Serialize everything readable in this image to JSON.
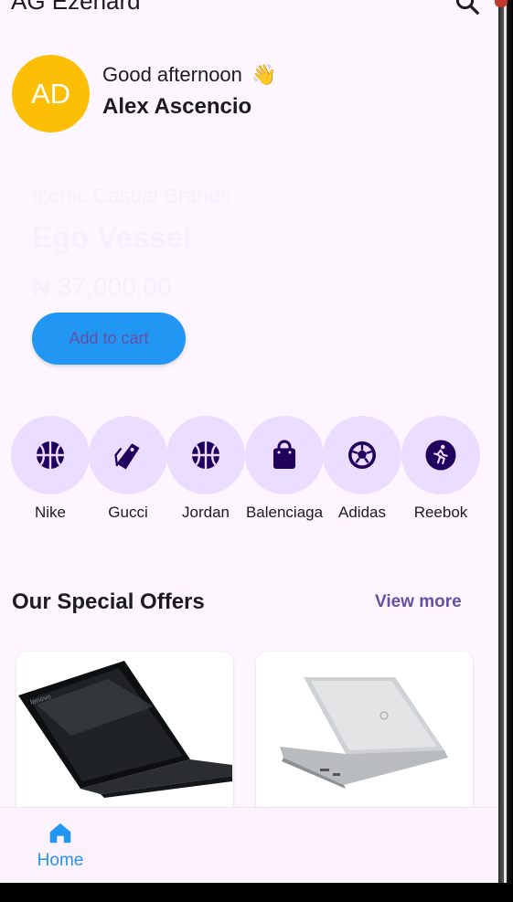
{
  "app_bar": {
    "title": "AG Ezenard"
  },
  "greeting": {
    "avatar_initials": "AD",
    "text": "Good afternoon",
    "emoji": "👋",
    "name": "Alex Ascencio"
  },
  "banner": {
    "subtitle": "Iconic Casual Brands",
    "title": "Ego Vessel",
    "price": "₦ 37,000.00",
    "button_label": "Add to cart"
  },
  "brands": [
    {
      "label": "Nike",
      "icon": "basketball-icon"
    },
    {
      "label": "Gucci",
      "icon": "tag-icon"
    },
    {
      "label": "Jordan",
      "icon": "basketball-icon"
    },
    {
      "label": "Balenciaga",
      "icon": "shopping-bag-icon"
    },
    {
      "label": "Adidas",
      "icon": "soccer-ball-icon"
    },
    {
      "label": "Reebok",
      "icon": "running-icon"
    }
  ],
  "offers": {
    "title": "Our Special Offers",
    "view_more": "View more"
  },
  "bottom_nav": {
    "home_label": "Home"
  },
  "colors": {
    "background": "#fdf6fe",
    "avatar": "#fdbf06",
    "primary_button": "#2196f3",
    "accent": "#6750a4",
    "brand_circle": "#eaddff",
    "brand_icon": "#21005d"
  }
}
